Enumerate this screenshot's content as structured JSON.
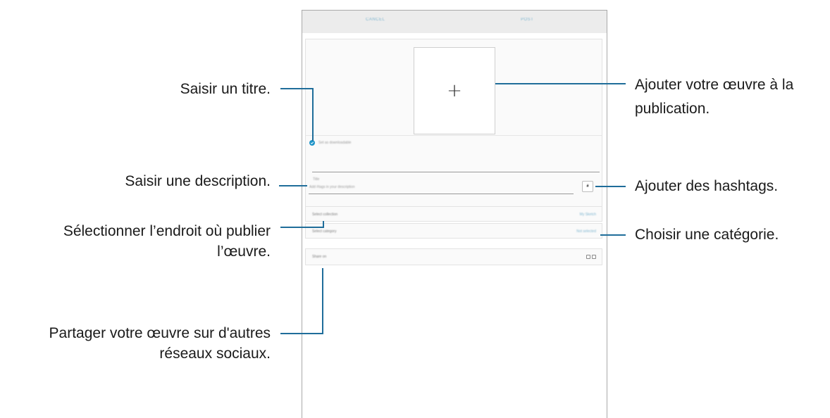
{
  "screen": {
    "appbar": {
      "cancel_label": "CANCEL",
      "post_label": "POST"
    },
    "add_artwork_symbol": "+",
    "share_community_label": "Set as downloadable",
    "title_placeholder": "Title",
    "description_placeholder": "Add #tags in your description",
    "hashtag_symbol": "#",
    "rows": {
      "collection_label": "Select collection",
      "collection_value": "My Sketch",
      "category_label": "Select category",
      "category_value": "Not selected",
      "share_label": "Share on"
    },
    "social_icons": [
      "facebook-icon",
      "twitter-icon"
    ]
  },
  "callouts": {
    "title": "Saisir un titre.",
    "description": "Saisir une description.",
    "location_line1": "Sélectionner l’endroit où publier",
    "location_line2": "l’œuvre.",
    "share_line1": "Partager votre œuvre sur d'autres",
    "share_line2": "réseaux sociaux.",
    "add_work_line1": "Ajouter votre œuvre à la",
    "add_work_line2": "publication.",
    "hashtags": "Ajouter des hashtags.",
    "category": "Choisir une catégorie."
  },
  "colors": {
    "leader_line": "#1f6d9a",
    "accent": "#1e94c8"
  }
}
